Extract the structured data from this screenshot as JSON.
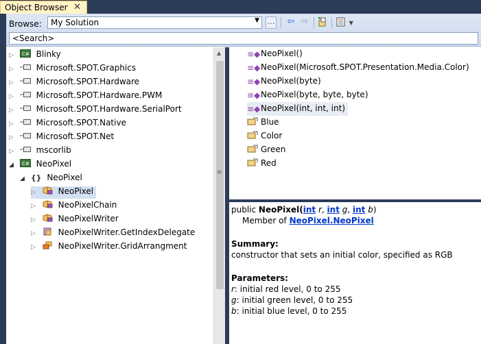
{
  "tab": {
    "title": "Object Browser"
  },
  "toolbar": {
    "browse_label": "Browse:",
    "browse_value": "My Solution",
    "more_label": "..."
  },
  "search": {
    "value": "<Search>"
  },
  "tree": {
    "items": [
      {
        "label": "Blinky",
        "icon": "csharp-project-icon",
        "expanded": false
      },
      {
        "label": "Microsoft.SPOT.Graphics",
        "icon": "reference-icon",
        "expanded": false
      },
      {
        "label": "Microsoft.SPOT.Hardware",
        "icon": "reference-icon",
        "expanded": false
      },
      {
        "label": "Microsoft.SPOT.Hardware.PWM",
        "icon": "reference-icon",
        "expanded": false
      },
      {
        "label": "Microsoft.SPOT.Hardware.SerialPort",
        "icon": "reference-icon",
        "expanded": false
      },
      {
        "label": "Microsoft.SPOT.Native",
        "icon": "reference-icon",
        "expanded": false
      },
      {
        "label": "Microsoft.SPOT.Net",
        "icon": "reference-icon",
        "expanded": false
      },
      {
        "label": "mscorlib",
        "icon": "reference-icon",
        "expanded": false
      },
      {
        "label": "NeoPixel",
        "icon": "csharp-project-icon",
        "expanded": true
      },
      {
        "label": "NeoPixel",
        "icon": "namespace-icon",
        "expanded": true
      },
      {
        "label": "NeoPixel",
        "icon": "class-icon",
        "expanded": false,
        "selected": true
      },
      {
        "label": "NeoPixelChain",
        "icon": "class-icon",
        "expanded": false
      },
      {
        "label": "NeoPixelWriter",
        "icon": "class-icon",
        "expanded": false
      },
      {
        "label": "NeoPixelWriter.GetIndexDelegate",
        "icon": "delegate-icon",
        "expanded": false
      },
      {
        "label": "NeoPixelWriter.GridArrangment",
        "icon": "enum-icon",
        "expanded": false
      }
    ]
  },
  "members": [
    {
      "label": "NeoPixel()",
      "icon": "constructor-icon"
    },
    {
      "label": "NeoPixel(Microsoft.SPOT.Presentation.Media.Color)",
      "icon": "constructor-icon"
    },
    {
      "label": "NeoPixel(byte)",
      "icon": "constructor-icon"
    },
    {
      "label": "NeoPixel(byte, byte, byte)",
      "icon": "constructor-icon"
    },
    {
      "label": "NeoPixel(int, int, int)",
      "icon": "constructor-icon",
      "selected": true
    },
    {
      "label": "Blue",
      "icon": "property-icon"
    },
    {
      "label": "Color",
      "icon": "property-icon"
    },
    {
      "label": "Green",
      "icon": "property-icon"
    },
    {
      "label": "Red",
      "icon": "property-icon"
    }
  ],
  "details": {
    "prefix": "public ",
    "name": "NeoPixel",
    "open_paren": "(",
    "p1_type": "int",
    "p1_name": " r",
    "comma1": ", ",
    "p2_type": "int",
    "p2_name": " g",
    "comma2": ", ",
    "p3_type": "int",
    "p3_name": " b",
    "close_paren": ")",
    "member_of_prefix": "Member of ",
    "member_of_ns": "NeoPixel",
    "member_of_dot": ".",
    "member_of_class": "NeoPixel",
    "summary_heading": "Summary:",
    "summary_text": "constructor that sets an initial color, specified as RGB",
    "parameters_heading": "Parameters:",
    "params": [
      {
        "name": "r",
        "text": ": initial red level, 0 to 255"
      },
      {
        "name": "g",
        "text": ": initial green level, 0 to 255"
      },
      {
        "name": "b",
        "text": ": initial blue level, 0 to 255"
      }
    ]
  },
  "colors": {
    "frame_bg": "#2b3c59",
    "tab_bg": "#fff3c8",
    "link": "#0037c8",
    "selection": "#d4e0f1"
  }
}
